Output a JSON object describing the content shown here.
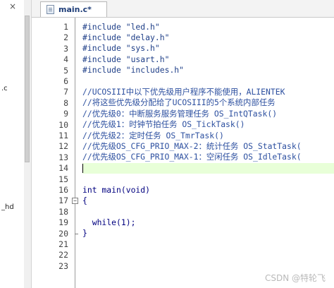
{
  "project_panel": {
    "close_label": "×",
    "fragments": [
      ".c",
      "_hd"
    ]
  },
  "tab": {
    "label": "main.c*"
  },
  "editor": {
    "lines": [
      {
        "n": "1",
        "text": "#include \"led.h\"",
        "kind": "include"
      },
      {
        "n": "2",
        "text": "#include \"delay.h\"",
        "kind": "include"
      },
      {
        "n": "3",
        "text": "#include \"sys.h\"",
        "kind": "include"
      },
      {
        "n": "4",
        "text": "#include \"usart.h\"",
        "kind": "include"
      },
      {
        "n": "5",
        "text": "#include \"includes.h\"",
        "kind": "include"
      },
      {
        "n": "6",
        "text": "",
        "kind": "plain"
      },
      {
        "n": "7",
        "text": "//UCOSIII中以下优先级用户程序不能使用，ALIENTEK",
        "kind": "comment"
      },
      {
        "n": "8",
        "text": "//将这些优先级分配给了UCOSIII的5个系统内部任务",
        "kind": "comment"
      },
      {
        "n": "9",
        "text": "//优先级0：中断服务服务管理任务 OS_IntQTask()",
        "kind": "comment"
      },
      {
        "n": "10",
        "text": "//优先级1：时钟节拍任务 OS_TickTask()",
        "kind": "comment"
      },
      {
        "n": "11",
        "text": "//优先级2：定时任务 OS_TmrTask()",
        "kind": "comment"
      },
      {
        "n": "12",
        "text": "//优先级OS_CFG_PRIO_MAX-2：统计任务 OS_StatTask(",
        "kind": "comment"
      },
      {
        "n": "13",
        "text": "//优先级OS_CFG_PRIO_MAX-1：空闲任务 OS_IdleTask(",
        "kind": "comment"
      },
      {
        "n": "14",
        "text": "",
        "kind": "current"
      },
      {
        "n": "15",
        "text": "",
        "kind": "plain"
      },
      {
        "n": "16",
        "text": "int main(void)",
        "kind": "plain"
      },
      {
        "n": "17",
        "text": "{",
        "kind": "plain"
      },
      {
        "n": "18",
        "text": "",
        "kind": "plain"
      },
      {
        "n": "19",
        "text": "  while(1);",
        "kind": "plain"
      },
      {
        "n": "20",
        "text": "}",
        "kind": "plain"
      },
      {
        "n": "21",
        "text": "",
        "kind": "plain"
      },
      {
        "n": "22",
        "text": "",
        "kind": "plain"
      },
      {
        "n": "23",
        "text": "",
        "kind": "plain"
      }
    ],
    "fold_marker": "−"
  },
  "watermark": "CSDN @特轮飞"
}
